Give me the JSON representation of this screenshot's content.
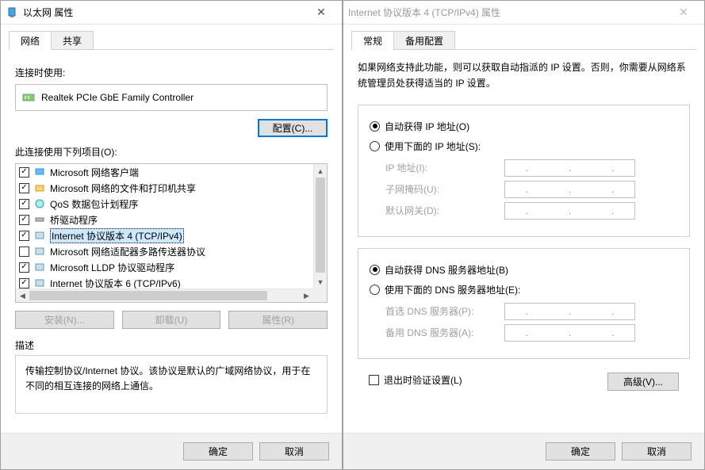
{
  "left": {
    "title": "以太网 属性",
    "tabs": {
      "network": "网络",
      "share": "共享"
    },
    "connect_using": "连接时使用:",
    "adapter": "Realtek PCIe GbE Family Controller",
    "configure": "配置(C)...",
    "uses_items": "此连接使用下列项目(O):",
    "items": [
      {
        "checked": true,
        "label": "Microsoft 网络客户端"
      },
      {
        "checked": true,
        "label": "Microsoft 网络的文件和打印机共享"
      },
      {
        "checked": true,
        "label": "QoS 数据包计划程序"
      },
      {
        "checked": true,
        "label": "桥驱动程序"
      },
      {
        "checked": true,
        "label": "Internet 协议版本 4 (TCP/IPv4)",
        "selected": true
      },
      {
        "checked": false,
        "label": "Microsoft 网络适配器多路传送器协议"
      },
      {
        "checked": true,
        "label": "Microsoft LLDP 协议驱动程序"
      },
      {
        "checked": true,
        "label": "Internet 协议版本 6 (TCP/IPv6)"
      }
    ],
    "install": "安装(N)...",
    "uninstall": "卸载(U)",
    "properties": "属性(R)",
    "desc_label": "描述",
    "desc_text": "传输控制协议/Internet 协议。该协议是默认的广域网络协议，用于在不同的相互连接的网络上通信。",
    "ok": "确定",
    "cancel": "取消"
  },
  "right": {
    "title": "Internet 协议版本 4 (TCP/IPv4) 属性",
    "tabs": {
      "general": "常规",
      "alt": "备用配置"
    },
    "info": "如果网络支持此功能，则可以获取自动指派的 IP 设置。否则，你需要从网络系统管理员处获得适当的 IP 设置。",
    "ip_auto": "自动获得 IP 地址(O)",
    "ip_manual": "使用下面的 IP 地址(S):",
    "ip_label": "IP 地址(I):",
    "mask_label": "子网掩码(U):",
    "gw_label": "默认网关(D):",
    "dns_auto": "自动获得 DNS 服务器地址(B)",
    "dns_manual": "使用下面的 DNS 服务器地址(E):",
    "dns1_label": "首选 DNS 服务器(P):",
    "dns2_label": "备用 DNS 服务器(A):",
    "validate": "退出时验证设置(L)",
    "advanced": "高级(V)...",
    "ok": "确定",
    "cancel": "取消"
  }
}
